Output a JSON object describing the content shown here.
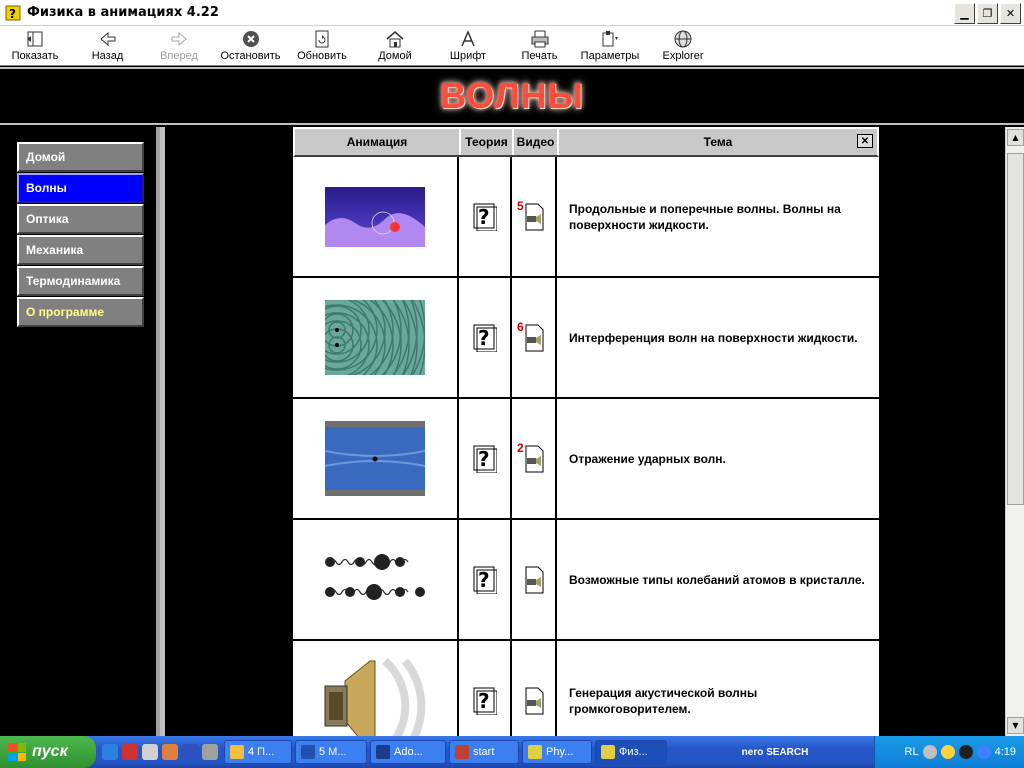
{
  "window": {
    "title": "Физика в анимациях 4.22"
  },
  "toolbar": {
    "show": "Показать",
    "back": "Назад",
    "forward": "Вперед",
    "stop": "Остановить",
    "refresh": "Обновить",
    "home": "Домой",
    "font": "Шрифт",
    "print": "Печать",
    "options": "Параметры",
    "explorer": "Explorer"
  },
  "banner": {
    "title": "ВОЛНЫ"
  },
  "menu": {
    "items": [
      {
        "label": "Домой",
        "active": false
      },
      {
        "label": "Волны",
        "active": true
      },
      {
        "label": "Оптика",
        "active": false
      },
      {
        "label": "Механика",
        "active": false
      },
      {
        "label": "Термодинамика",
        "active": false
      },
      {
        "label": "О программе",
        "active": false
      }
    ]
  },
  "table": {
    "headers": {
      "animation": "Анимация",
      "theory": "Теория",
      "video": "Видео",
      "topic": "Тема"
    },
    "rows": [
      {
        "video_count": "5",
        "topic": "Продольные и поперечные волны.  Волны на поверхности жидкости."
      },
      {
        "video_count": "6",
        "topic": "Интерференция волн на поверхности жидкости."
      },
      {
        "video_count": "2",
        "topic": "Отражение ударных волн."
      },
      {
        "video_count": "",
        "topic": "Возможные типы колебаний атомов в кристалле."
      },
      {
        "video_count": "",
        "topic": "Генерация акустической волны громкоговорителем."
      }
    ]
  },
  "taskbar": {
    "start": "пуск",
    "tasks": [
      "4 П...",
      "5 М...",
      "Ado...",
      "start",
      "Phy...",
      "Физ..."
    ],
    "nero": "nero SEARCH",
    "lang": "RL",
    "clock": "4:19"
  },
  "colors": {
    "active_menu": "#0000ff",
    "banner_text": "#ff4c3a",
    "video_number": "#cc0000"
  }
}
